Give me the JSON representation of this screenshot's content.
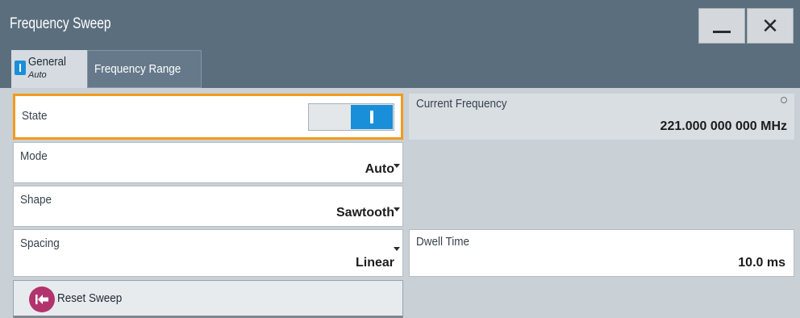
{
  "window": {
    "title": "Frequency Sweep",
    "minimize_label": "—",
    "close_label": "✕"
  },
  "tabs": {
    "general": {
      "label": "General",
      "sub": "Auto"
    },
    "frequency_range": {
      "label": "Frequency Range"
    }
  },
  "state": {
    "label": "State",
    "value": "on"
  },
  "mode": {
    "label": "Mode",
    "value": "Auto"
  },
  "shape": {
    "label": "Shape",
    "value": "Sawtooth"
  },
  "spacing": {
    "label": "Spacing",
    "value": "Linear"
  },
  "reset": {
    "label": "Reset Sweep"
  },
  "current_frequency": {
    "label": "Current Frequency",
    "value": "221.000 000 000 MHz"
  },
  "dwell_time": {
    "label": "Dwell Time",
    "value": "10.0 ms"
  },
  "colors": {
    "accent": "#1a8fd9",
    "focus": "#f39a1b",
    "titlebar": "#5b6e7d",
    "reset_icon": "#b1346d"
  },
  "icons": {
    "minimize": "minimize-icon",
    "close": "close-icon",
    "reset": "reset-icon",
    "dropdown": "chevron-down-icon",
    "settings": "gear-icon"
  }
}
